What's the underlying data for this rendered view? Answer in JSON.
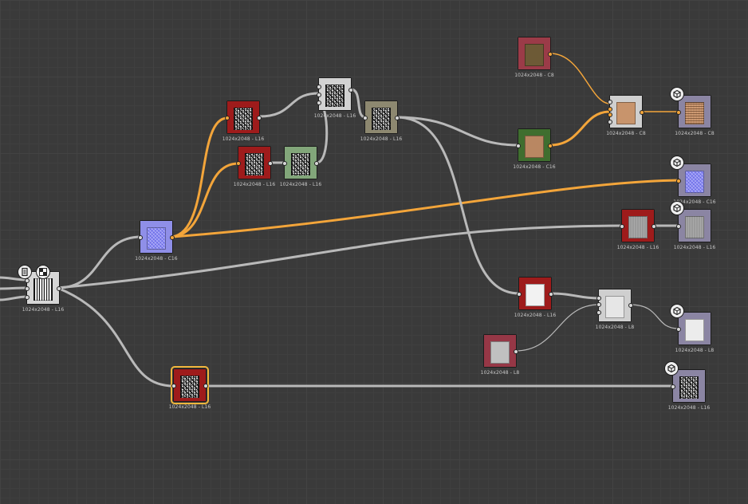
{
  "app": {
    "accent": "#f3a53a",
    "wire_grey": "#b9b9b9"
  },
  "graph": {
    "nodes": [
      {
        "id": "n_input",
        "label": "1024x2048 - L16",
        "frame": "#d6d6d6",
        "thumb": "tx-stripes",
        "thumb_color": ""
      },
      {
        "id": "n_normal",
        "label": "1024x2048 - C16",
        "frame": "#8f8fe8",
        "thumb": "tx-normal",
        "thumb_color": ""
      },
      {
        "id": "n_red1",
        "label": "1024x2048 - L16",
        "frame": "#9e1b1b",
        "thumb": "tx-noise",
        "thumb_color": ""
      },
      {
        "id": "n_red2",
        "label": "1024x2048 - L16",
        "frame": "#9e1b1b",
        "thumb": "tx-noise",
        "thumb_color": ""
      },
      {
        "id": "n_green_small",
        "label": "1024x2048 - L16",
        "frame": "#82a67a",
        "thumb": "tx-noise",
        "thumb_color": ""
      },
      {
        "id": "n_blend_grey",
        "label": "1024x2048 - L16",
        "frame": "#d2d2d2",
        "thumb": "tx-noise",
        "thumb_color": ""
      },
      {
        "id": "n_olive",
        "label": "1024x2048 - L16",
        "frame": "#8d8870",
        "thumb": "tx-noise",
        "thumb_color": ""
      },
      {
        "id": "n_brown_top",
        "label": "1024x2048 - C8",
        "frame": "#9b3b48",
        "thumb": "",
        "thumb_color": "#6d5a36"
      },
      {
        "id": "n_green_dark",
        "label": "1024x2048 - C16",
        "frame": "#3f6e2f",
        "thumb": "",
        "thumb_color": "#b98762"
      },
      {
        "id": "n_blend_c8",
        "label": "1024x2048 - C8",
        "frame": "#cfcfcf",
        "thumb": "",
        "thumb_color": "#c8946c"
      },
      {
        "id": "n_out_base",
        "label": "1024x2048 - C8",
        "frame": "#8b85a3",
        "thumb": "tx-wood",
        "thumb_color": ""
      },
      {
        "id": "n_out_normal",
        "label": "1024x2048 - C16",
        "frame": "#8b85a3",
        "thumb": "tx-normal",
        "thumb_color": ""
      },
      {
        "id": "n_red3",
        "label": "1024x2048 - L16",
        "frame": "#9e1b1b",
        "thumb": "tx-grey",
        "thumb_color": ""
      },
      {
        "id": "n_out_rough",
        "label": "1024x2048 - L16",
        "frame": "#8b85a3",
        "thumb": "tx-grey",
        "thumb_color": ""
      },
      {
        "id": "n_red4",
        "label": "1024x2048 - L16",
        "frame": "#9e1b1b",
        "thumb": "",
        "thumb_color": "#f2f2f2"
      },
      {
        "id": "n_blend_l8",
        "label": "1024x2048 - L8",
        "frame": "#cfcfcf",
        "thumb": "",
        "thumb_color": "#e6e6e6"
      },
      {
        "id": "n_rose",
        "label": "1024x2048 - L8",
        "frame": "#963746",
        "thumb": "",
        "thumb_color": "#c0c0c0"
      },
      {
        "id": "n_out_l8",
        "label": "1024x2048 - L8",
        "frame": "#8b85a3",
        "thumb": "",
        "thumb_color": "#ececec"
      },
      {
        "id": "n_selected",
        "label": "1024x2048 - L16",
        "frame": "#9e1b1b",
        "thumb": "tx-noise",
        "thumb_color": ""
      },
      {
        "id": "n_out_height",
        "label": "1024x2048 - L16",
        "frame": "#8b85a3",
        "thumb": "tx-noise",
        "thumb_color": ""
      }
    ],
    "badges": [
      {
        "id": "b_doc",
        "icon": "document-icon"
      },
      {
        "id": "b_checker",
        "icon": "checker-icon"
      },
      {
        "id": "b_out1",
        "icon": "output-cube-icon"
      },
      {
        "id": "b_out2",
        "icon": "output-cube-icon"
      },
      {
        "id": "b_out3",
        "icon": "output-cube-icon"
      },
      {
        "id": "b_out4",
        "icon": "output-cube-icon"
      },
      {
        "id": "b_out5",
        "icon": "output-cube-icon"
      }
    ]
  }
}
